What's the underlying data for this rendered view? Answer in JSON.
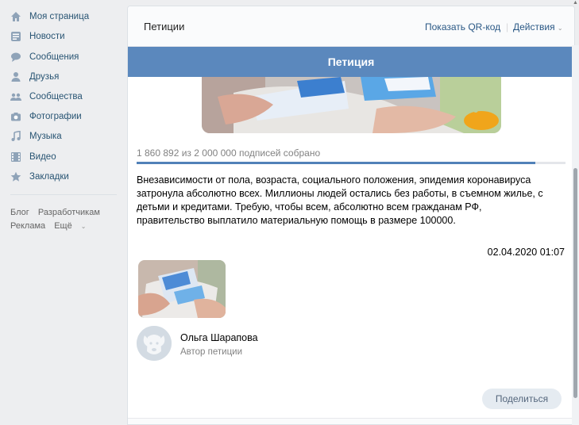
{
  "sidebar": {
    "items": [
      {
        "label": "Моя страница",
        "icon": "home-icon"
      },
      {
        "label": "Новости",
        "icon": "news-icon"
      },
      {
        "label": "Сообщения",
        "icon": "messages-icon"
      },
      {
        "label": "Друзья",
        "icon": "friends-icon"
      },
      {
        "label": "Сообщества",
        "icon": "groups-icon"
      },
      {
        "label": "Фотографии",
        "icon": "camera-icon"
      },
      {
        "label": "Музыка",
        "icon": "music-icon"
      },
      {
        "label": "Видео",
        "icon": "video-icon"
      },
      {
        "label": "Закладки",
        "icon": "star-icon"
      }
    ],
    "footer": {
      "blog": "Блог",
      "developers": "Разработчикам",
      "ads": "Реклама",
      "more": "Ещё"
    }
  },
  "header": {
    "title": "Петиции",
    "qr_label": "Показать QR-код",
    "actions_label": "Действия"
  },
  "petition": {
    "bar_title": "Петиция",
    "signatures": "1 860 892 из 2 000 000 подписей собрано",
    "progress": 0.93,
    "description": "Внезависимости от пола, возраста, социального положения, эпидемия коронавируса затронула абсолютно всех. Миллионы людей остались без работы, в съемном жилье, с детьми и кредитами. Требую, чтобы всем, абсолютно всем гражданам РФ, правительство выплатило материальную помощь в размере 100000.",
    "date": "02.04.2020 01:07",
    "author_name": "Ольга Шарапова",
    "author_role": "Автор петиции",
    "share_label": "Поделиться"
  },
  "colors": {
    "accent": "#5b88bd",
    "link": "#2a5885",
    "progress": "#5181b8"
  }
}
